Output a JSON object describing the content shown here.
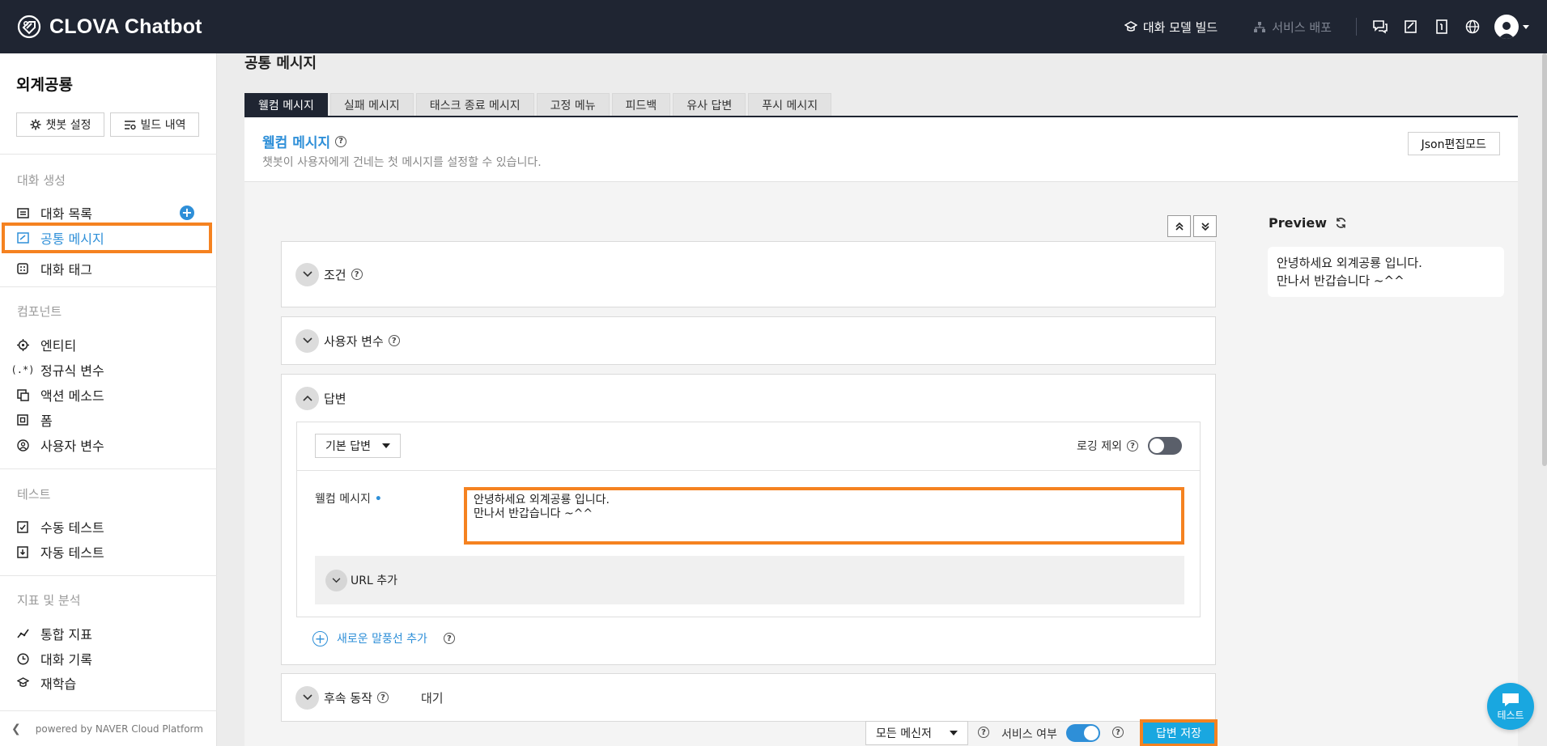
{
  "app": {
    "name": "CLOVA Chatbot"
  },
  "topbar": {
    "build_label": "대화 모델 빌드",
    "deploy_label": "서비스 배포"
  },
  "sidebar": {
    "project_name": "외계공룡",
    "settings_btn": "챗봇 설정",
    "build_history_btn": "빌드 내역",
    "sections": {
      "conversation": "대화 생성",
      "component": "컴포넌트",
      "test": "테스트",
      "analytics": "지표 및 분석"
    },
    "items": {
      "dialog_list": "대화 목록",
      "common_message": "공통 메시지",
      "dialog_tag": "대화 태그",
      "entity": "엔티티",
      "regex": "정규식 변수",
      "action_method": "액션 메소드",
      "form": "폼",
      "user_var": "사용자 변수",
      "manual_test": "수동 테스트",
      "auto_test": "자동 테스트",
      "overall_metrics": "통합 지표",
      "dialog_log": "대화 기록",
      "retrain": "재학습"
    },
    "footer": "powered by NAVER Cloud Platform"
  },
  "main": {
    "page_title": "공통 메시지",
    "tabs": [
      "웰컴 메시지",
      "실패 메시지",
      "태스크 종료 메시지",
      "고정 메뉴",
      "피드백",
      "유사 답변",
      "푸시 메시지"
    ],
    "section_title": "웰컴 메시지",
    "section_desc": "챗봇이 사용자에게 건네는 첫 메시지를 설정할 수 있습니다.",
    "json_btn": "Json편집모드",
    "cards": {
      "condition": "조건",
      "user_var": "사용자 변수",
      "answer": "답변",
      "follow_up": "후속 동작",
      "follow_up_value": "대기"
    },
    "answer": {
      "type_select": "기본 답변",
      "logging_label": "로깅 제외",
      "field_label": "웰컴 메시지",
      "required_mark": "•",
      "message": "안녕하세요 외계공룡 입니다.\n만나서 반갑습니다 ~^^",
      "url_add": "URL 추가",
      "add_bubble": "새로운 말풍선 추가"
    },
    "bottom": {
      "messenger_select": "모든 메신저",
      "service_label": "서비스 여부",
      "save_btn": "답변 저장"
    },
    "preview": {
      "title": "Preview",
      "message": "안녕하세요 외계공룡 입니다.\n만나서 반갑습니다 ~^^"
    }
  },
  "fab": {
    "label": "테스트"
  },
  "colors": {
    "accent": "#2e8fd8",
    "highlight": "#f58220",
    "topbar": "#1f2532",
    "save": "#19a7e0"
  }
}
